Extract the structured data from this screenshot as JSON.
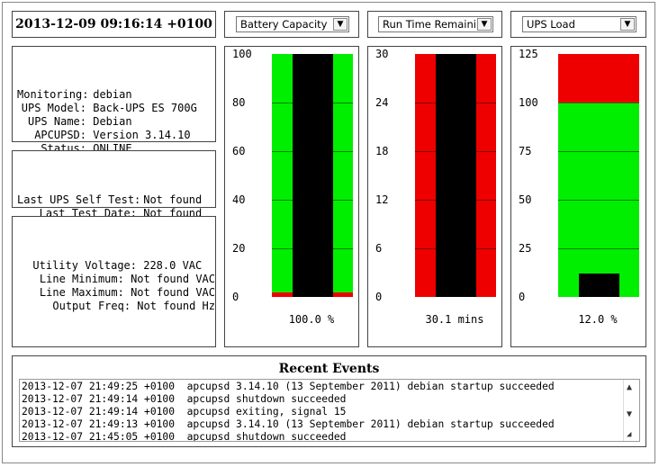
{
  "timestamp": "2013-12-09 09:16:14 +0100",
  "status_info": [
    {
      "key": "Monitoring:",
      "value": "debian"
    },
    {
      "key": "UPS Model:",
      "value": "Back-UPS ES 700G"
    },
    {
      "key": "UPS Name:",
      "value": "Debian"
    },
    {
      "key": "APCUPSD:",
      "value": "Version 3.14.10"
    },
    {
      "key": "Status:",
      "value": "ONLINE"
    }
  ],
  "selftest_info": [
    {
      "key": "Last UPS Self Test:",
      "value": "Not found"
    },
    {
      "key": "Last Test Date:",
      "value": "Not found"
    }
  ],
  "voltage_info": [
    {
      "key": "Utility Voltage:",
      "value": "228.0 VAC"
    },
    {
      "key": "Line Minimum:",
      "value": "Not found VAC"
    },
    {
      "key": "Line Maximum:",
      "value": "Not found VAC"
    },
    {
      "key": "Output Freq:",
      "value": "Not found Hz"
    }
  ],
  "gauges": [
    {
      "select": "Battery Capacity",
      "ticks": [
        "100",
        "80",
        "60",
        "40",
        "20",
        "0"
      ],
      "max": 100,
      "value": 100.0,
      "value_label": "100.0 %",
      "band": "green",
      "warn_below": 2,
      "colors": {
        "good": "#00ee00",
        "warn": "#ee0000",
        "value": "#000000"
      }
    },
    {
      "select": "Run Time Remaining",
      "ticks": [
        "30",
        "24",
        "18",
        "12",
        "6",
        "0"
      ],
      "max": 30,
      "value": 30.1,
      "value_label": "30.1 mins",
      "band": "red",
      "colors": {
        "good": "#00ee00",
        "warn": "#ee0000",
        "value": "#000000"
      }
    },
    {
      "select": "UPS Load",
      "ticks": [
        "125",
        "100",
        "75",
        "50",
        "25",
        "0"
      ],
      "max": 125,
      "value": 12.0,
      "value_label": "12.0 %",
      "band": "load",
      "warn_above": 100,
      "colors": {
        "good": "#00ee00",
        "warn": "#ee0000",
        "value": "#000000"
      }
    }
  ],
  "events": {
    "title": "Recent Events",
    "items": [
      "2013-12-07 21:49:25 +0100  apcupsd 3.14.10 (13 September 2011) debian startup succeeded",
      "2013-12-07 21:49:14 +0100  apcupsd shutdown succeeded",
      "2013-12-07 21:49:14 +0100  apcupsd exiting, signal 15",
      "2013-12-07 21:49:13 +0100  apcupsd 3.14.10 (13 September 2011) debian startup succeeded",
      "2013-12-07 21:45:05 +0100  apcupsd shutdown succeeded"
    ]
  }
}
